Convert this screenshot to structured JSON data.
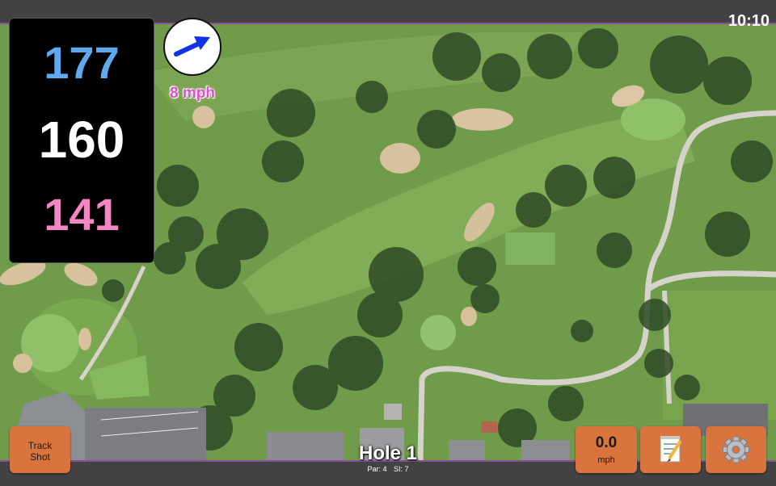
{
  "status_bar": {
    "time": "10:10"
  },
  "distances": {
    "back": "177",
    "middle": "160",
    "front": "141"
  },
  "wind": {
    "speed_label": "8 mph",
    "direction": "east-northeast"
  },
  "hole": {
    "title": "Hole 1",
    "par_label": "Par: 4",
    "si_label": "SI: 7"
  },
  "buttons": {
    "track_shot_line1": "Track",
    "track_shot_line2": "Shot",
    "wind_value": "0.0",
    "wind_unit": "mph",
    "notes_icon": "notepad-icon",
    "settings_icon": "gear-icon"
  },
  "colors": {
    "back_distance": "#5fa9ee",
    "middle_distance": "#ffffff",
    "front_distance": "#f486c3",
    "wind_label": "#e44bd0",
    "button_bg": "#d9743e",
    "bar_accent": "#8a4f9a"
  }
}
